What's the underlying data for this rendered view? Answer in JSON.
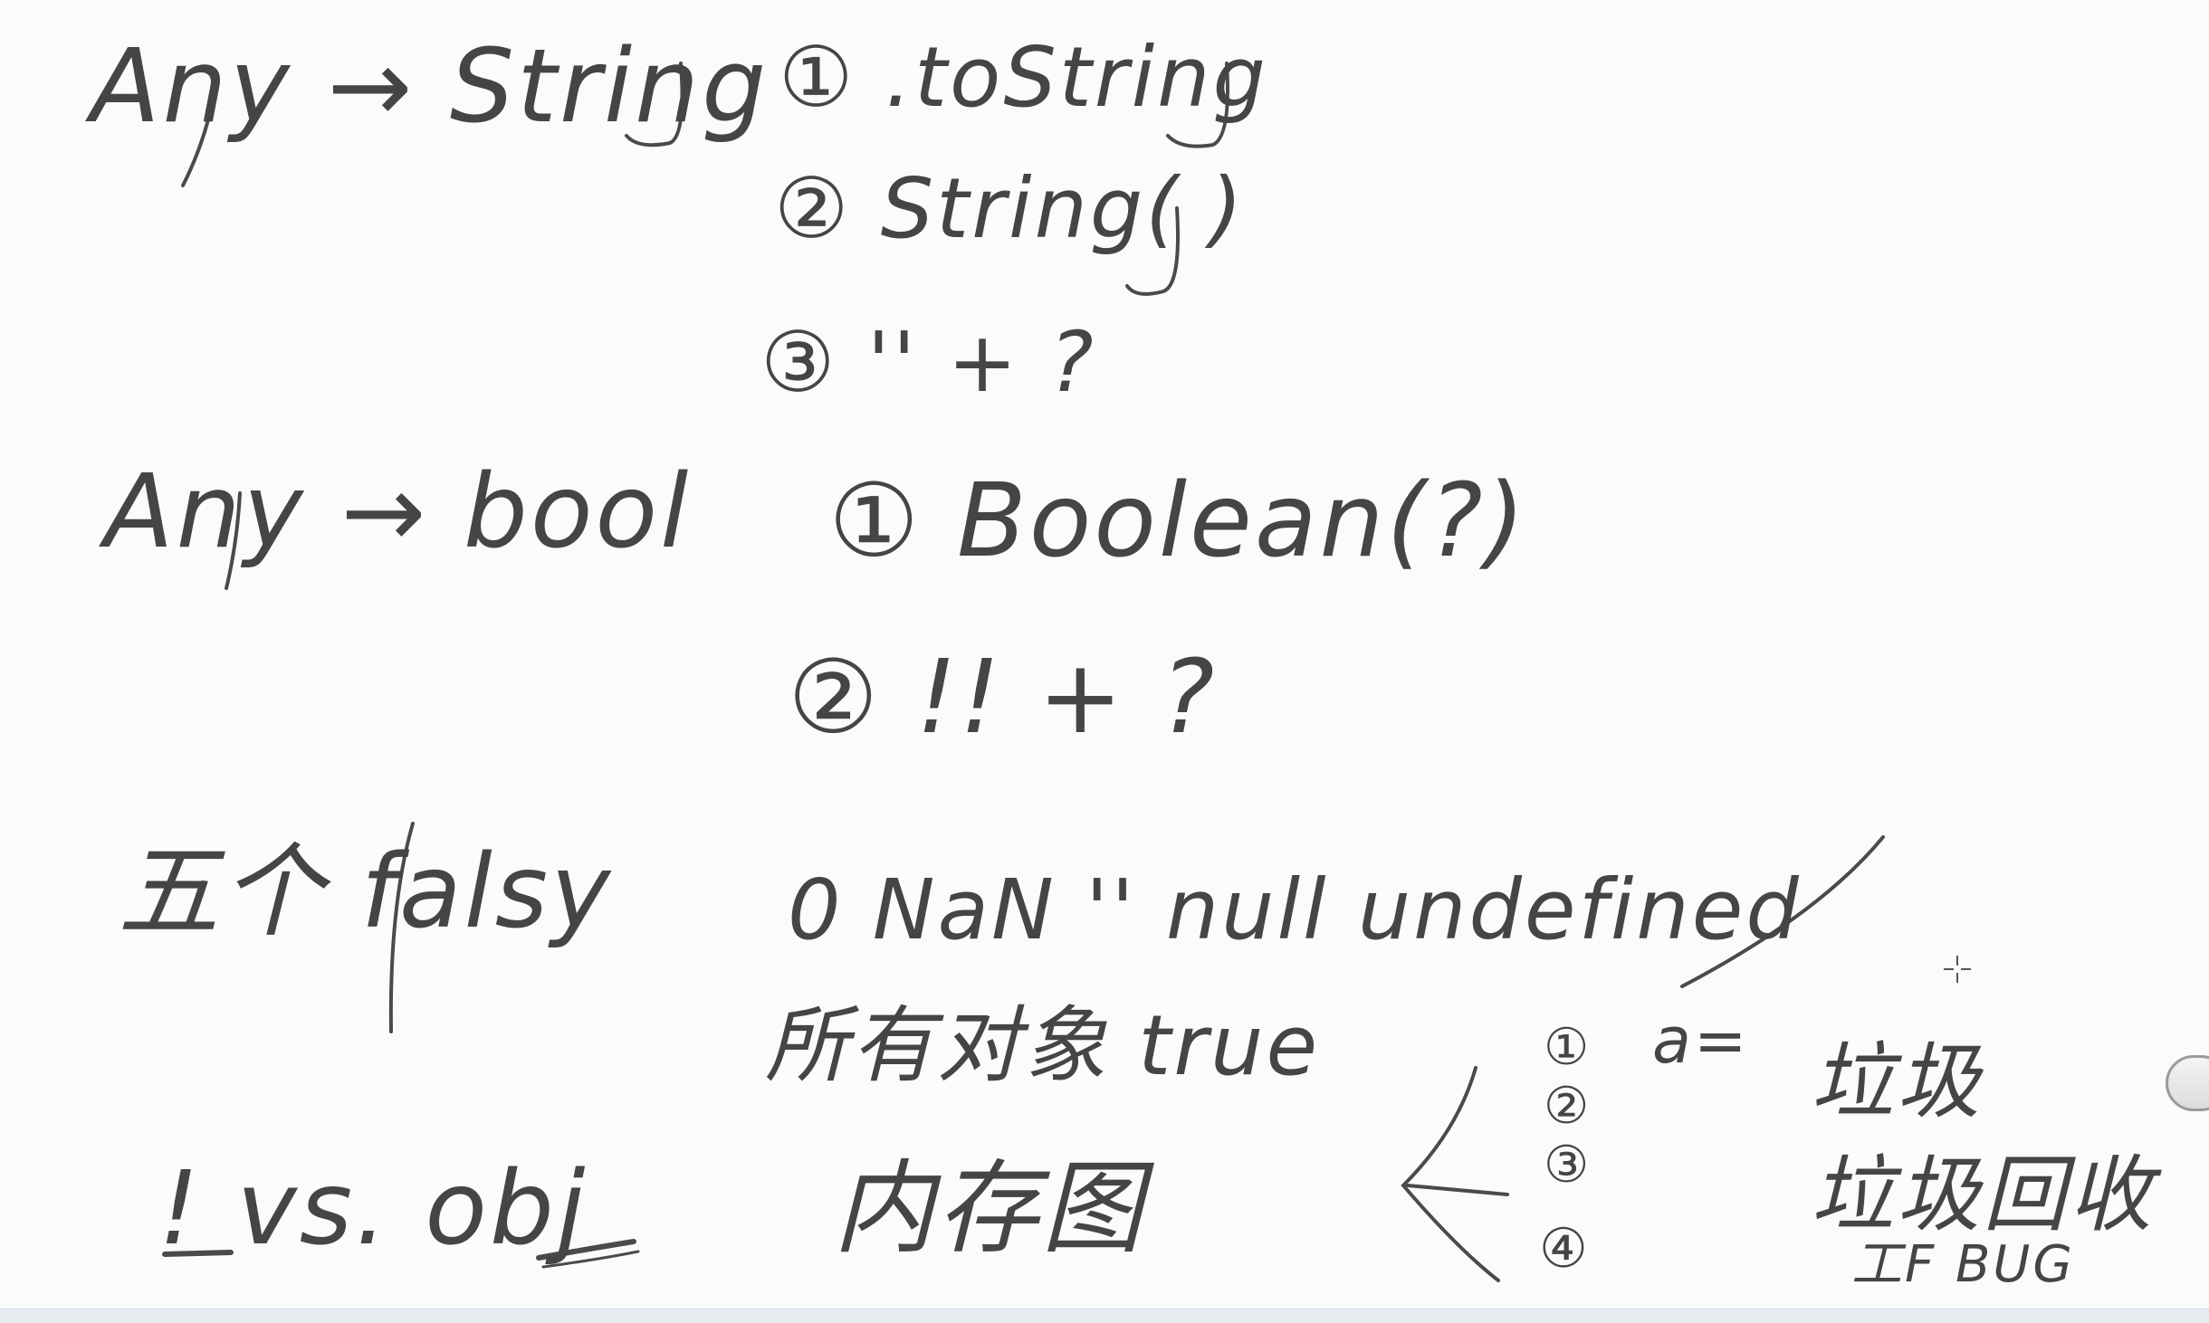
{
  "notes": {
    "row1": {
      "left": "Any → String",
      "items": [
        "① .toString",
        "② String( )",
        "③ '' + ?"
      ]
    },
    "row2": {
      "left": "Any → bool",
      "items": [
        "① Boolean(?)",
        "② !! + ?"
      ]
    },
    "row3": {
      "left": "五个 falsy",
      "values": "0 NaN '' null undefined",
      "note": "所有对象 true",
      "index": "a="
    },
    "row4": {
      "left": "! vs. obj",
      "mid": "内存图",
      "list": [
        "①",
        "②",
        "③",
        "④"
      ],
      "right1": "垃圾",
      "right2": "垃圾回收",
      "right3": "工F BUG"
    }
  }
}
